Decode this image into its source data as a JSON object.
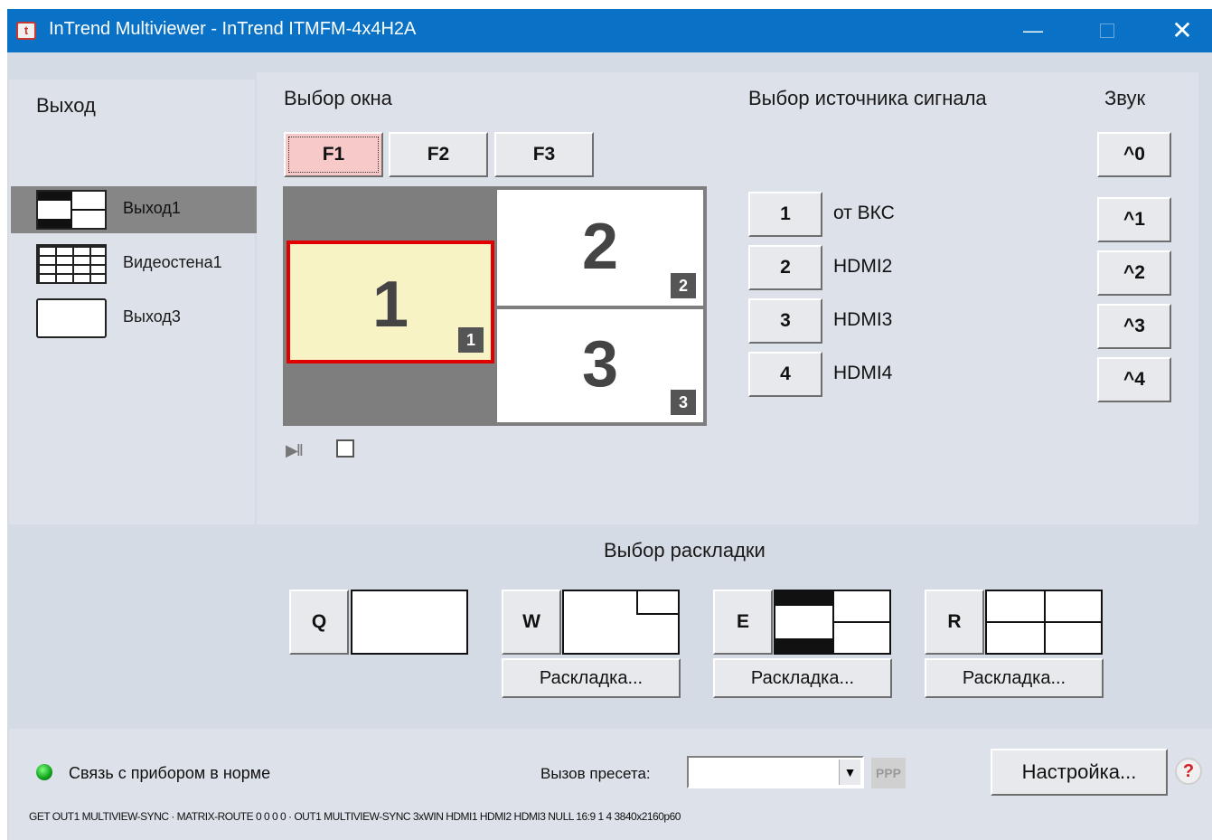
{
  "window": {
    "title": "InTrend Multiviewer - InTrend ITMFM-4x4H2A",
    "minimize": "—",
    "close": "✕"
  },
  "output": {
    "heading": "Выход",
    "items": [
      {
        "label": "Выход1",
        "selected": true
      },
      {
        "label": "Видеостена1",
        "selected": false
      },
      {
        "label": "Выход3",
        "selected": false
      }
    ]
  },
  "window_select": {
    "heading": "Выбор окна",
    "tabs": [
      {
        "label": "F1",
        "active": true
      },
      {
        "label": "F2",
        "active": false
      },
      {
        "label": "F3",
        "active": false
      }
    ],
    "windows": [
      {
        "number": "1",
        "badge": "1",
        "selected": true
      },
      {
        "number": "2",
        "badge": "2",
        "selected": false
      },
      {
        "number": "3",
        "badge": "3",
        "selected": false
      }
    ],
    "play_icon": "▶II"
  },
  "source": {
    "heading": "Выбор источника сигнала",
    "items": [
      {
        "button": "1",
        "label": "от ВКС"
      },
      {
        "button": "2",
        "label": "HDMI2"
      },
      {
        "button": "3",
        "label": "HDMI3"
      },
      {
        "button": "4",
        "label": "HDMI4"
      }
    ]
  },
  "sound": {
    "heading": "Звук",
    "buttons": [
      "^0",
      "^1",
      "^2",
      "^3",
      "^4"
    ]
  },
  "layouts": {
    "heading": "Выбор раскладки",
    "items": [
      {
        "key": "Q",
        "config_label": ""
      },
      {
        "key": "W",
        "config_label": "Раскладка..."
      },
      {
        "key": "E",
        "config_label": "Раскладка..."
      },
      {
        "key": "R",
        "config_label": "Раскладка..."
      }
    ]
  },
  "status": {
    "connection": "Связь с прибором в норме",
    "preset_label": "Вызов пресета:",
    "preset_value": "",
    "ppp": "PPP",
    "settings": "Настройка...",
    "help": "?",
    "command_log": "GET OUT1 MULTIVIEW-SYNC · MATRIX-ROUTE 0 0 0 0 · OUT1 MULTIVIEW-SYNC 3xWIN HDMI1 HDMI2 HDMI3 NULL 16:9 1 4 3840x2160p60"
  },
  "colors": {
    "titlebar": "#0a72c6",
    "selected_window_border": "#e10000",
    "selected_window_fill": "#f8f3c4",
    "pressed_tab": "#f8c9c9",
    "led": "#0ea01a"
  }
}
